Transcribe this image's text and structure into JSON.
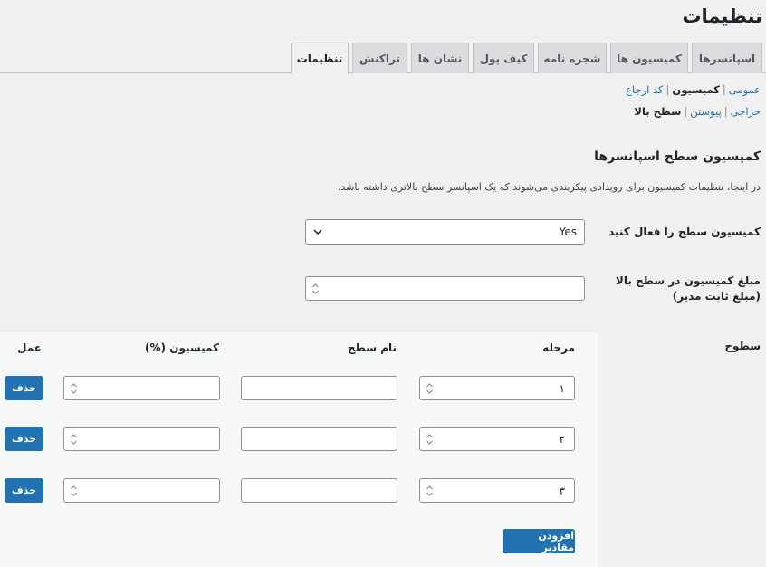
{
  "page": {
    "title": "تنظیمات"
  },
  "tabs": [
    {
      "label": "اسپانسرها",
      "active": false
    },
    {
      "label": "کمیسیون ها",
      "active": false
    },
    {
      "label": "شجره نامه",
      "active": false
    },
    {
      "label": "کیف پول",
      "active": false
    },
    {
      "label": "نشان ها",
      "active": false
    },
    {
      "label": "تراکنش",
      "active": false
    },
    {
      "label": "تنظیمات",
      "active": true
    }
  ],
  "subnav": {
    "row1": {
      "general": "عمومی",
      "commission": "کمیسیون",
      "referral": "کد ارجاع"
    },
    "row2": {
      "auction": "حراجی",
      "join": "پیوستن",
      "top_level": "سطح بالا"
    },
    "separator": "|"
  },
  "section": {
    "title": "کمیسیون سطح اسپانسرها",
    "description": "در اینجا، تنظیمات کمیسیون برای رویدادی پیکربندی می‌شوند که یک اسپانسر سطح بالاتری داشته باشد."
  },
  "fields": {
    "enable": {
      "label": "کمیسیون سطح را فعال کنید",
      "value": "Yes"
    },
    "amount": {
      "label": "مبلغ کمیسیون در سطح بالا (مبلغ ثابت مدیر)",
      "value": ""
    },
    "levels_label": "سطوح"
  },
  "levels": {
    "headers": {
      "stage": "مرحله",
      "level_name": "نام سطح",
      "commission": "کمیسیون (%)",
      "action": "عمل"
    },
    "rows": [
      {
        "stage": "۱",
        "name": "",
        "commission": "",
        "delete": "حذف"
      },
      {
        "stage": "۲",
        "name": "",
        "commission": "",
        "delete": "حذف"
      },
      {
        "stage": "۳",
        "name": "",
        "commission": "",
        "delete": "حذف"
      }
    ],
    "add_button": "افزودن مقادیر"
  },
  "colors": {
    "accent": "#2271b1",
    "background": "#f0f0f1",
    "panel": "#f6f7f7"
  },
  "icons": {
    "select": "chevron-down-icon",
    "number": "spinner-icon"
  }
}
